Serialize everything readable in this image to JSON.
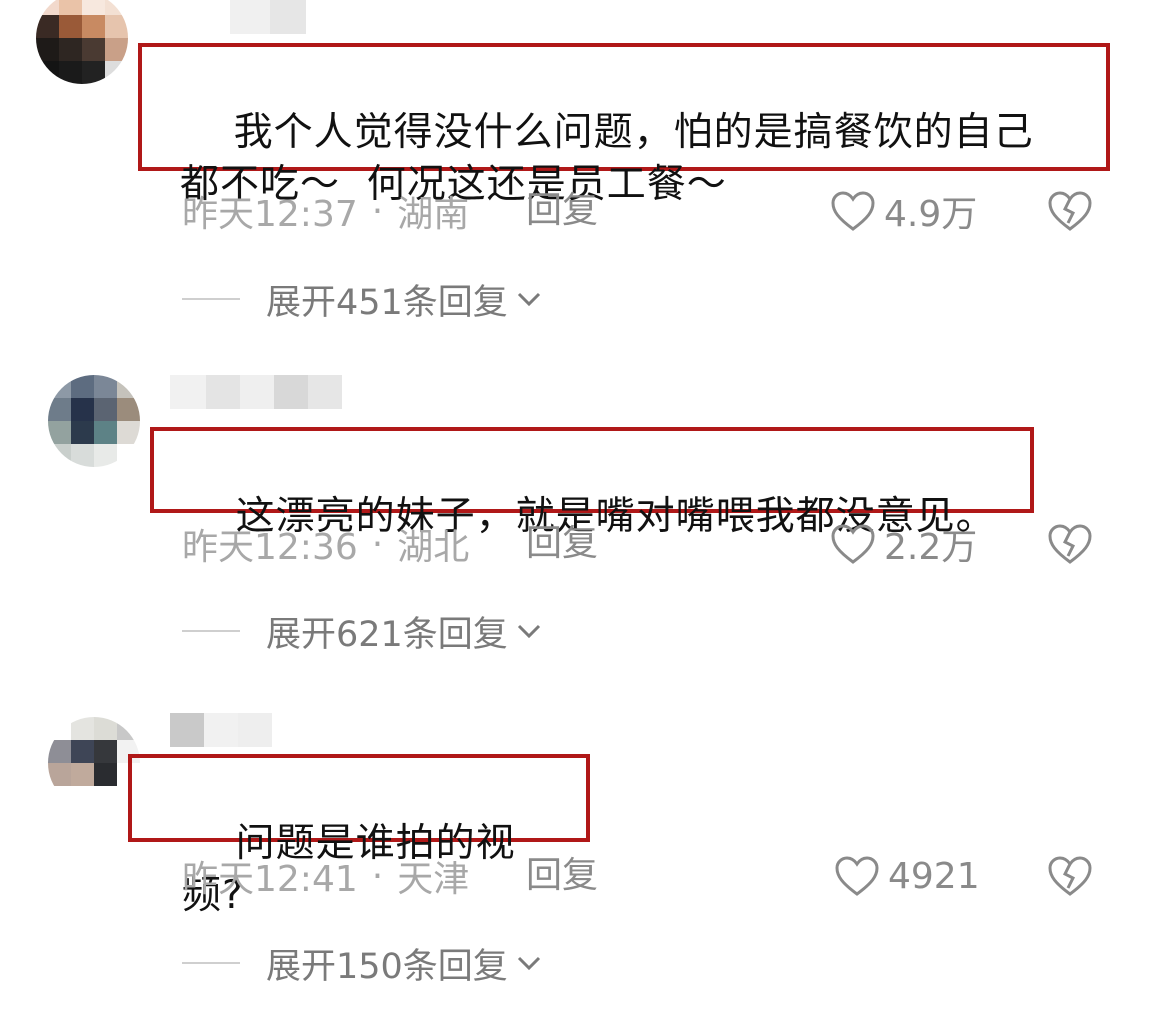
{
  "comments": [
    {
      "text": "我个人觉得没什么问题，怕的是搞餐饮的自己\n都不吃～  何况这还是员工餐～",
      "time": "昨天12:37",
      "separator": "·",
      "location": "湖南",
      "reply_label": "回复",
      "likes": "4.9万",
      "expand_label": "展开451条回复"
    },
    {
      "text": "这漂亮的妹子，就是嘴对嘴喂我都没意见。",
      "time": "昨天12:36",
      "separator": "·",
      "location": "湖北",
      "reply_label": "回复",
      "likes": "2.2万",
      "expand_label": "展开621条回复"
    },
    {
      "text": "问题是谁拍的视频?",
      "time": "昨天12:41",
      "separator": "·",
      "location": "天津",
      "reply_label": "回复",
      "likes": "4921",
      "expand_label": "展开150条回复"
    }
  ],
  "icons": {
    "like": "heart-outline-icon",
    "dislike": "broken-heart-icon",
    "expand": "chevron-down-icon"
  },
  "colors": {
    "highlight_border": "#b01818",
    "meta_text": "#a8a8a8",
    "action_text": "#8a8a8a"
  }
}
